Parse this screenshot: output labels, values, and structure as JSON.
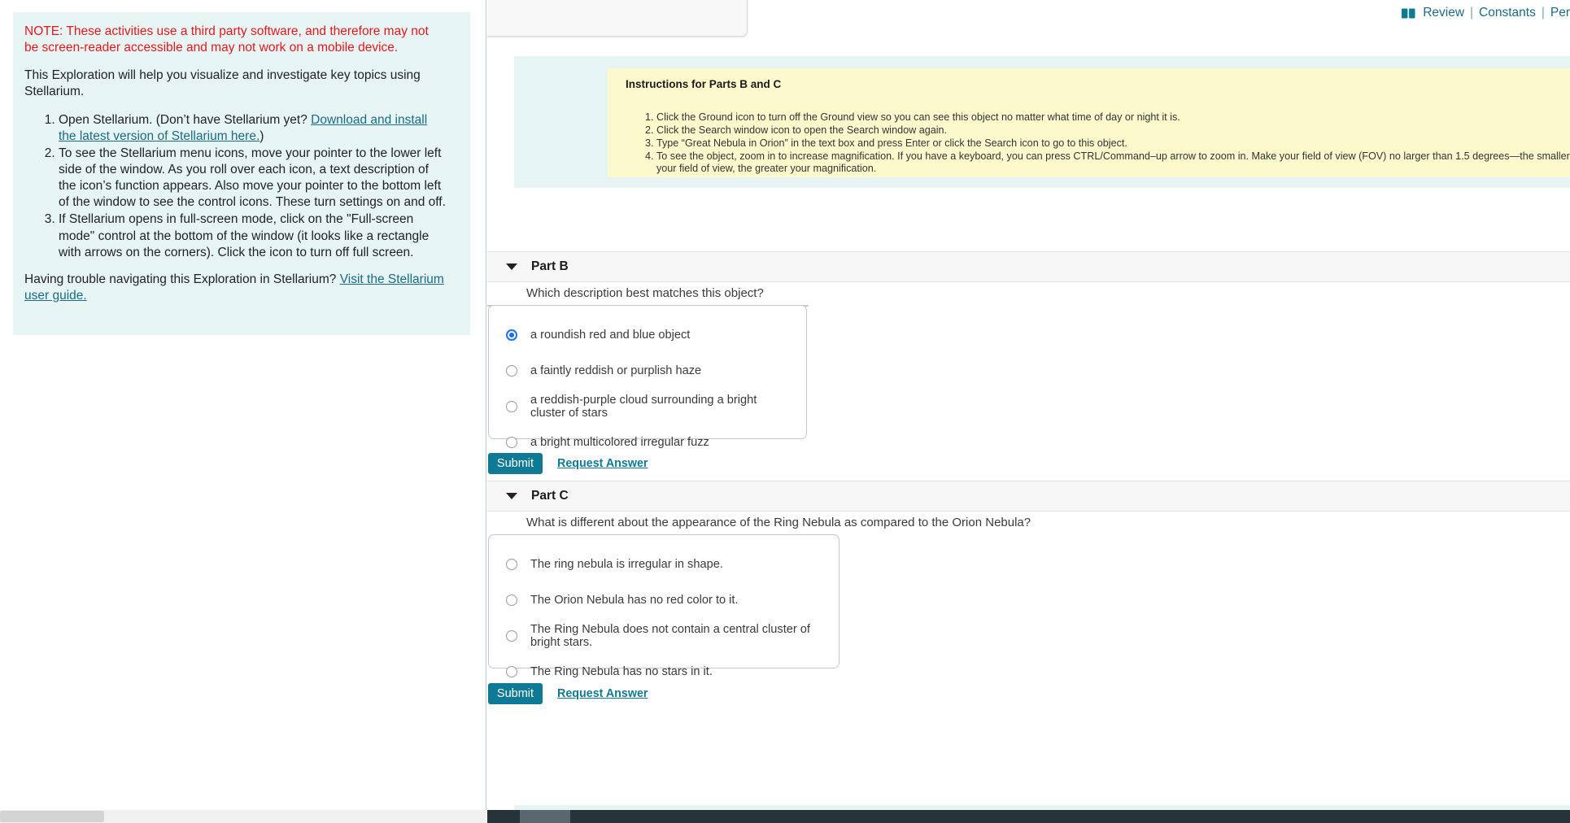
{
  "left_panel": {
    "note": "NOTE: These activities use a third party software, and therefore may not be screen-reader accessible and may not work on a mobile device.",
    "intro": "This Exploration will help you visualize and investigate key topics using Stellarium.",
    "steps": [
      {
        "pre": "Open Stellarium. (Don’t have Stellarium yet? ",
        "link": "Download and install the latest version of Stellarium here.",
        "post": ")"
      },
      {
        "pre": "To see the Stellarium menu icons, move your pointer to the lower left side of the window. As you roll over each icon, a text description of the icon’s function appears. Also move your pointer to the bottom left of the window to see the control icons. These turn settings on and off.",
        "link": "",
        "post": ""
      },
      {
        "pre": "If Stellarium opens in full-screen mode, click on the \"Full-screen mode\" control at the bottom of the window (it looks like a rectangle with arrows on the corners). Click the icon to turn off full screen.",
        "link": "",
        "post": ""
      }
    ],
    "help_pre": "Having trouble navigating this Exploration in Stellarium? ",
    "help_link": "Visit the Stellarium user guide."
  },
  "header": {
    "book_icon": "book-icon",
    "review": "Review",
    "constants": "Constants",
    "periodic": "Per",
    "separator": "|"
  },
  "instructions": {
    "title": "Instructions for Parts B and C",
    "items": [
      "Click the Ground icon to turn off the Ground view so you can see this object no matter what time of day or night it is.",
      "Click the Search window icon to open the Search window again.",
      "Type “Great Nebula in Orion” in the text box and press Enter or click the Search icon to go to this object.",
      "To see the object, zoom in to increase magnification. If you have a keyboard, you can press CTRL/Command–up arrow to zoom in. Make your field of view (FOV) no larger than 1.5 degrees—the smaller your field of view, the greater your magnification."
    ]
  },
  "part_b": {
    "label": "Part B",
    "question": "Which description best matches this object?",
    "options": [
      {
        "text": "a roundish red and blue object",
        "selected": true
      },
      {
        "text": "a faintly reddish or purplish haze",
        "selected": false
      },
      {
        "text": "a reddish-purple cloud surrounding a bright cluster of stars",
        "selected": false
      },
      {
        "text": "a bright multicolored irregular fuzz",
        "selected": false
      }
    ],
    "submit_label": "Submit",
    "request_label": "Request Answer"
  },
  "part_c": {
    "label": "Part C",
    "question": "What is different about the appearance of the Ring Nebula as compared to the Orion Nebula?",
    "options": [
      {
        "text": "The ring nebula is irregular in shape.",
        "selected": false
      },
      {
        "text": "The Orion Nebula has no red color to it.",
        "selected": false
      },
      {
        "text": "The Ring Nebula does not contain a central cluster of bright stars.",
        "selected": false
      },
      {
        "text": "The Ring Nebula has no stars in it.",
        "selected": false
      }
    ],
    "submit_label": "Submit",
    "request_label": "Request Answer"
  },
  "colors": {
    "accent_teal": "#0f7a96",
    "note_red": "#e8161b",
    "panel_blue": "#e7f4f4",
    "instruction_yellow": "#fcfacc",
    "radio_blue": "#1a73e8",
    "scrollbar_dark": "#26343a"
  }
}
